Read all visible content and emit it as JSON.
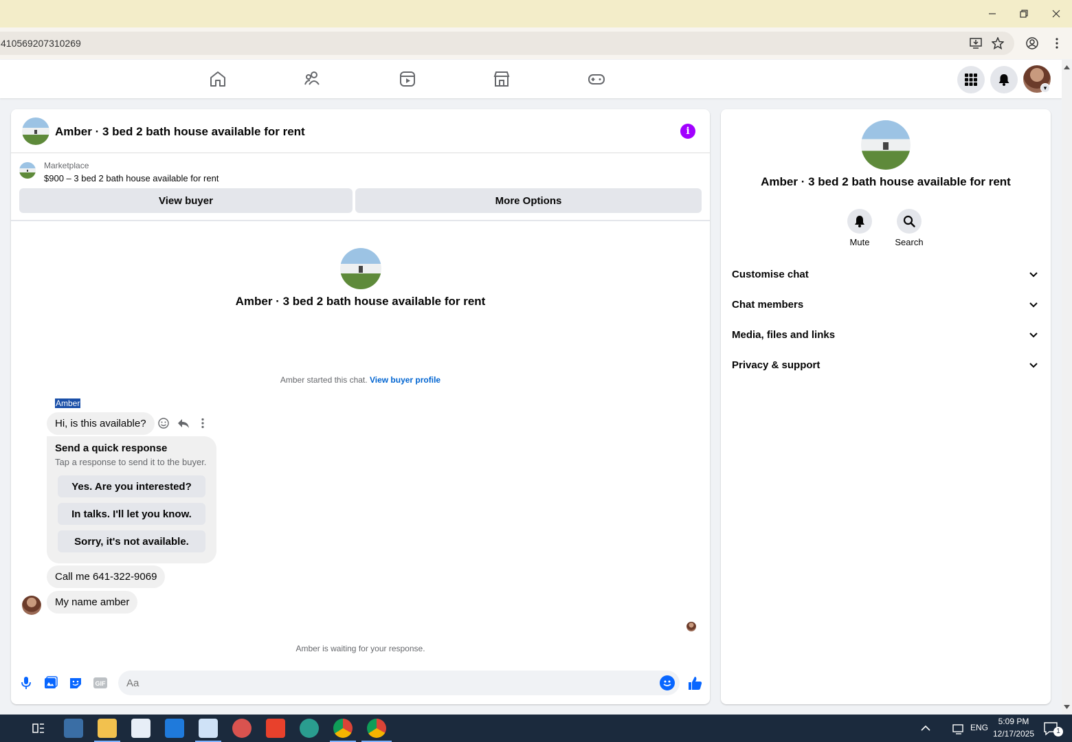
{
  "browser": {
    "url": "410569207310269"
  },
  "chat": {
    "title": "Amber · 3 bed 2 bath house available for rent",
    "marketplace_label": "Marketplace",
    "listing": "$900 – 3 bed 2 bath house available for rent",
    "view_buyer": "View buyer",
    "more_options": "More Options",
    "center_title": "Amber · 3 bed 2 bath house available for rent",
    "started_text": "Amber started this chat.",
    "view_buyer_profile": "View buyer profile",
    "sender_name": "Amber",
    "messages": [
      "Hi, is this available?",
      "Call me 641-322-9069",
      "My name amber"
    ],
    "quick_response": {
      "title": "Send a quick response",
      "subtitle": "Tap a response to send it to the buyer.",
      "options": [
        "Yes. Are you interested?",
        "In talks. I'll let you know.",
        "Sorry, it's not available."
      ]
    },
    "waiting_text": "Amber is waiting for your response.",
    "composer_placeholder": "Aa"
  },
  "side": {
    "title": "Amber · 3 bed 2 bath house available for rent",
    "mute_label": "Mute",
    "search_label": "Search",
    "sections": [
      "Customise chat",
      "Chat members",
      "Media, files and links",
      "Privacy & support"
    ]
  },
  "taskbar": {
    "language": "ENG",
    "time": "5:09 PM",
    "date": "12/17/2025",
    "notifications": "1"
  },
  "colors": {
    "accent": "#0866ff",
    "info": "#a100ff"
  }
}
